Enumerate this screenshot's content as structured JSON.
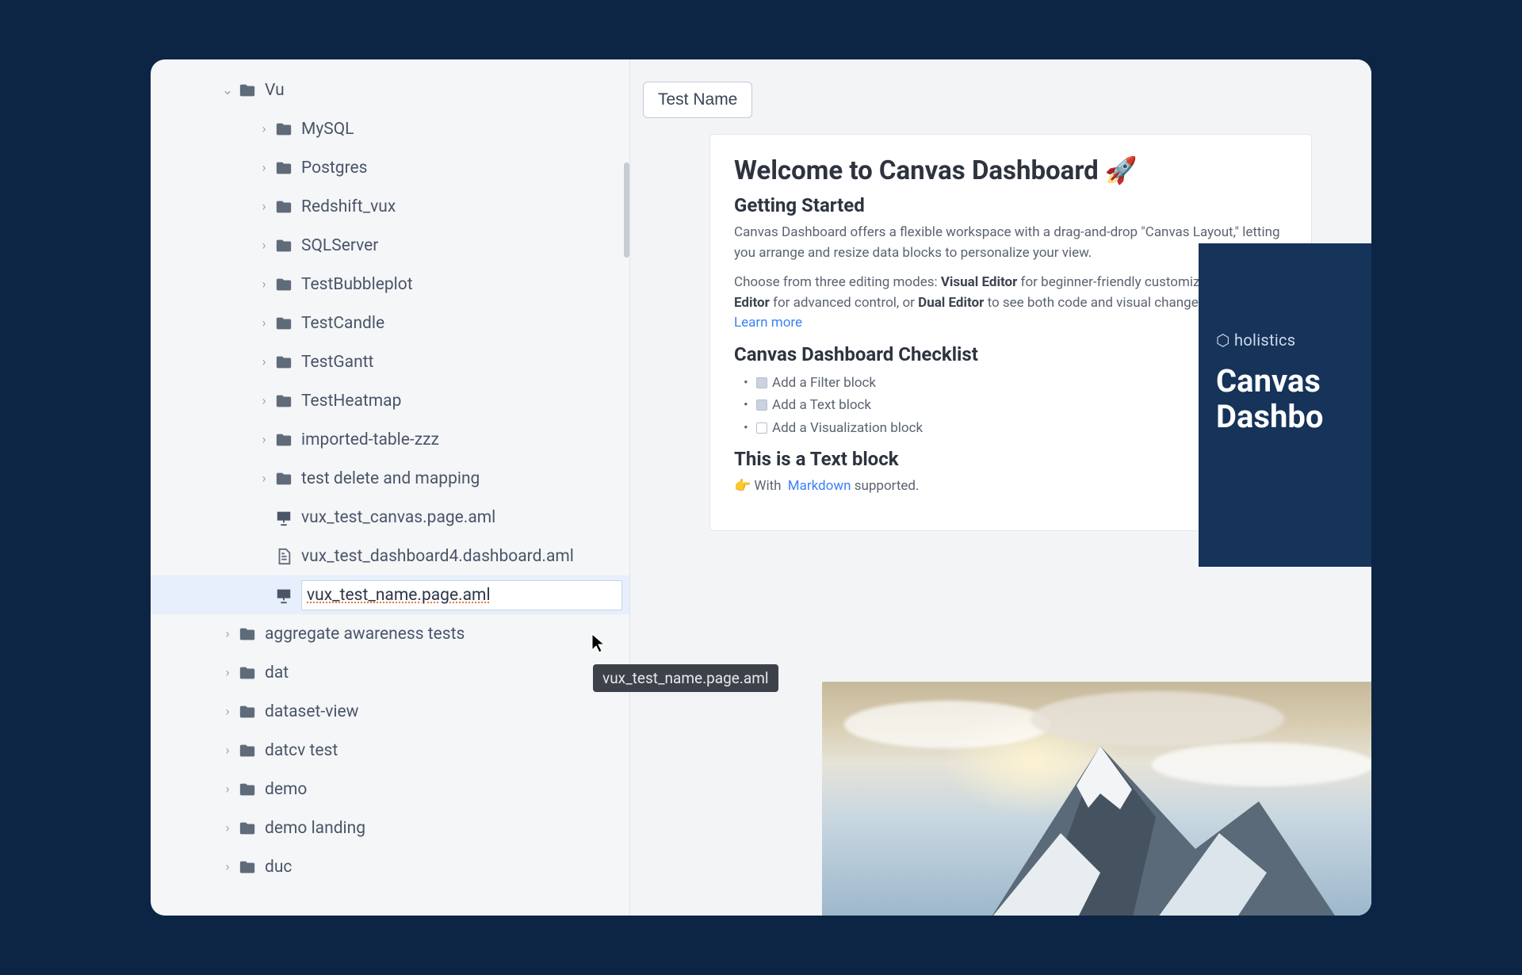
{
  "sidebar": {
    "root": {
      "label": "Vu"
    },
    "children": [
      {
        "type": "folder",
        "label": "MySQL"
      },
      {
        "type": "folder",
        "label": "Postgres"
      },
      {
        "type": "folder",
        "label": "Redshift_vux"
      },
      {
        "type": "folder",
        "label": "SQLServer"
      },
      {
        "type": "folder",
        "label": "TestBubbleplot"
      },
      {
        "type": "folder",
        "label": "TestCandle"
      },
      {
        "type": "folder",
        "label": "TestGantt"
      },
      {
        "type": "folder",
        "label": "TestHeatmap"
      },
      {
        "type": "folder",
        "label": "imported-table-zzz"
      },
      {
        "type": "folder",
        "label": "test delete and mapping"
      },
      {
        "type": "page",
        "label": "vux_test_canvas.page.aml"
      },
      {
        "type": "file",
        "label": "vux_test_dashboard4.dashboard.aml"
      },
      {
        "type": "page",
        "label": "vux_test_name.page.aml",
        "editing": true
      }
    ],
    "siblings": [
      {
        "label": "aggregate awareness tests"
      },
      {
        "label": "dat"
      },
      {
        "label": "dataset-view"
      },
      {
        "label": "datcv test"
      },
      {
        "label": "demo"
      },
      {
        "label": "demo landing"
      },
      {
        "label": "duc"
      }
    ],
    "rename_value": "vux_test_name.page.aml",
    "tooltip": "vux_test_name.page.aml"
  },
  "tab": {
    "label": "Test Name"
  },
  "doc": {
    "title": "Welcome to Canvas Dashboard 🚀",
    "h_getting_started": "Getting Started",
    "p1a": "Canvas Dashboard offers a flexible workspace with a drag-and-drop \"Canvas Layout,\" letting you arrange and resize data blocks to personalize your view.",
    "p2_pre": "Choose from three editing modes: ",
    "p2_b1": "Visual Editor",
    "p2_mid1": " for beginner-friendly customization, ",
    "p2_b2": "Code Editor",
    "p2_mid2": " for advanced control, or ",
    "p2_b3": "Dual Editor",
    "p2_post": " to see both code and visual changes side-by-side. ",
    "learn_more": "Learn more",
    "h_checklist": "Canvas Dashboard Checklist",
    "check1": "Add a Filter block",
    "check2": "Add a Text block",
    "check3": "Add a Visualization block",
    "h_textblock": "This is a Text block",
    "p3_pre": "👉 With ",
    "p3_link": "Markdown",
    "p3_post": " supported."
  },
  "promo": {
    "brand": "holistics",
    "line1": "Canvas",
    "line2": "Dashbo"
  }
}
